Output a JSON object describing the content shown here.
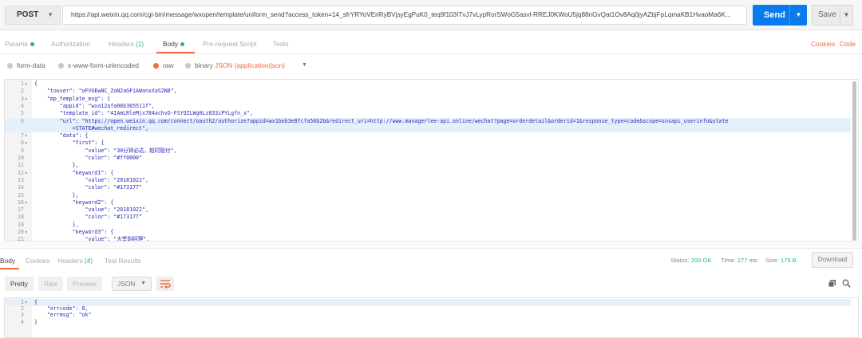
{
  "request": {
    "method": "POST",
    "url": "https://api.weixin.qq.com/cgi-bin/message/wxopen/template/uniform_send?access_token=14_sfrYRYoVEriRyBVjsyEgPuK0_teq9f103ITvJ7vLypRorSWoG5asvl-RREJ0KWoU5jq88nGvQat1Ov8Aq0jyAZbjFpLqmaKB1HvaoMa6K...",
    "send_label": "Send",
    "save_label": "Save"
  },
  "request_tabs": {
    "params": "Params",
    "authorization": "Authorization",
    "headers": "Headers",
    "headers_count": "(1)",
    "body": "Body",
    "pre_request": "Pre-request Script",
    "tests": "Tests",
    "cookies": "Cookies",
    "code": "Code"
  },
  "body_options": {
    "form_data": "form-data",
    "urlencoded": "x-www-form-urlencoded",
    "raw": "raw",
    "binary": "binary",
    "content_type": "JSON (application/json)"
  },
  "request_body": [
    {
      "n": "1",
      "fold": true,
      "text": "{"
    },
    {
      "n": "2",
      "fold": false,
      "text": "    \"touser\": \"oFVGEwNC_ZoN2aGFiAWanxXaS2N8\","
    },
    {
      "n": "3",
      "fold": true,
      "text": "    \"mp_template_msg\": {"
    },
    {
      "n": "4",
      "fold": false,
      "text": "        \"appid\": \"wxa12afa08b365511f\","
    },
    {
      "n": "5",
      "fold": false,
      "text": "        \"template_id\": \"4IAmLRleMjx784achvO-FSYQZLWg0Lz833iPYLgfn_x\","
    },
    {
      "n": "6",
      "fold": false,
      "hl": true,
      "text": "        \"url\": \"https://open.weixin.qq.com/connect/oauth2/authorize?appid=wx1beb3e8fcfa56b2b&redirect_uri=http://www.managerlee-api.online/wechat?page=orderdetail&orderid=1&response_type=code&scope=snsapi_userinfo&state"
    },
    {
      "n": "",
      "fold": false,
      "hl": true,
      "text": "            =STATE#wechat_redirect\","
    },
    {
      "n": "7",
      "fold": true,
      "text": "        \"data\": {"
    },
    {
      "n": "8",
      "fold": true,
      "text": "            \"first\": {"
    },
    {
      "n": "9",
      "fold": false,
      "text": "                \"value\": \"30分钟必达，超时赔付\","
    },
    {
      "n": "10",
      "fold": false,
      "text": "                \"color\": \"#ff0000\""
    },
    {
      "n": "11",
      "fold": false,
      "text": "            },"
    },
    {
      "n": "12",
      "fold": true,
      "text": "            \"keyword1\": {"
    },
    {
      "n": "13",
      "fold": false,
      "text": "                \"value\": \"20181022\","
    },
    {
      "n": "14",
      "fold": false,
      "text": "                \"color\": \"#173177\""
    },
    {
      "n": "15",
      "fold": false,
      "text": "            },"
    },
    {
      "n": "16",
      "fold": true,
      "text": "            \"keyword2\": {"
    },
    {
      "n": "17",
      "fold": false,
      "text": "                \"value\": \"20181022\","
    },
    {
      "n": "18",
      "fold": false,
      "text": "                \"color\": \"#173177\""
    },
    {
      "n": "19",
      "fold": false,
      "text": "            },"
    },
    {
      "n": "20",
      "fold": true,
      "text": "            \"keyword3\": {"
    },
    {
      "n": "21",
      "fold": false,
      "text": "                \"value\": \"大堂副经理\","
    }
  ],
  "response_tabs": {
    "body": "Body",
    "cookies": "Cookies",
    "headers": "Headers",
    "headers_count": "(4)",
    "test_results": "Test Results"
  },
  "response_meta": {
    "status_label": "Status:",
    "status_value": "200 OK",
    "time_label": "Time:",
    "time_value": "277 ms",
    "size_label": "Size:",
    "size_value": "175 B",
    "download_label": "Download"
  },
  "response_view": {
    "pretty": "Pretty",
    "raw": "Raw",
    "preview": "Preview",
    "format": "JSON"
  },
  "response_body": [
    {
      "n": "1",
      "fold": true,
      "hl": true,
      "text": "{"
    },
    {
      "n": "2",
      "fold": false,
      "text": "    \"errcode\": 0,"
    },
    {
      "n": "3",
      "fold": false,
      "text": "    \"errmsg\": \"ok\""
    },
    {
      "n": "4",
      "fold": false,
      "text": "}"
    }
  ],
  "colors": {
    "accent": "#f26b3a",
    "send": "#097bed",
    "success": "#26b47f",
    "code": "#2a2ab8"
  },
  "icons": [
    "caret-down-icon",
    "wrap-lines-icon",
    "copy-icon",
    "search-icon"
  ]
}
